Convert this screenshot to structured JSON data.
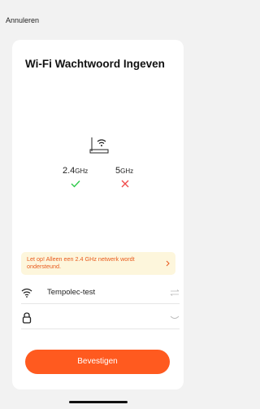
{
  "header": {
    "cancel_label": "Annuleren"
  },
  "card": {
    "title": "Wi-Fi Wachtwoord Ingeven",
    "bands": [
      {
        "ghz": "2.4",
        "unit": "GHz",
        "supported": true
      },
      {
        "ghz": "5",
        "unit": "GHz",
        "supported": false
      }
    ],
    "warning": "Let op! Alleen een 2.4 GHz netwerk wordt ondersteund.",
    "wifi_ssid": "Tempolec-test",
    "password_value": "",
    "confirm_label": "Bevestigen"
  },
  "colors": {
    "accent": "#ff5a1f",
    "success": "#2ec94a",
    "error": "#f04b4b",
    "warning_bg": "#fdf6dc"
  },
  "icons": {
    "router": "router-icon",
    "check": "check-icon",
    "cross": "cross-icon",
    "wifi": "wifi-icon",
    "lock": "lock-icon",
    "switch": "swap-arrows-icon",
    "eye": "eye-closed-icon",
    "chevron": "chevron-right-icon"
  }
}
